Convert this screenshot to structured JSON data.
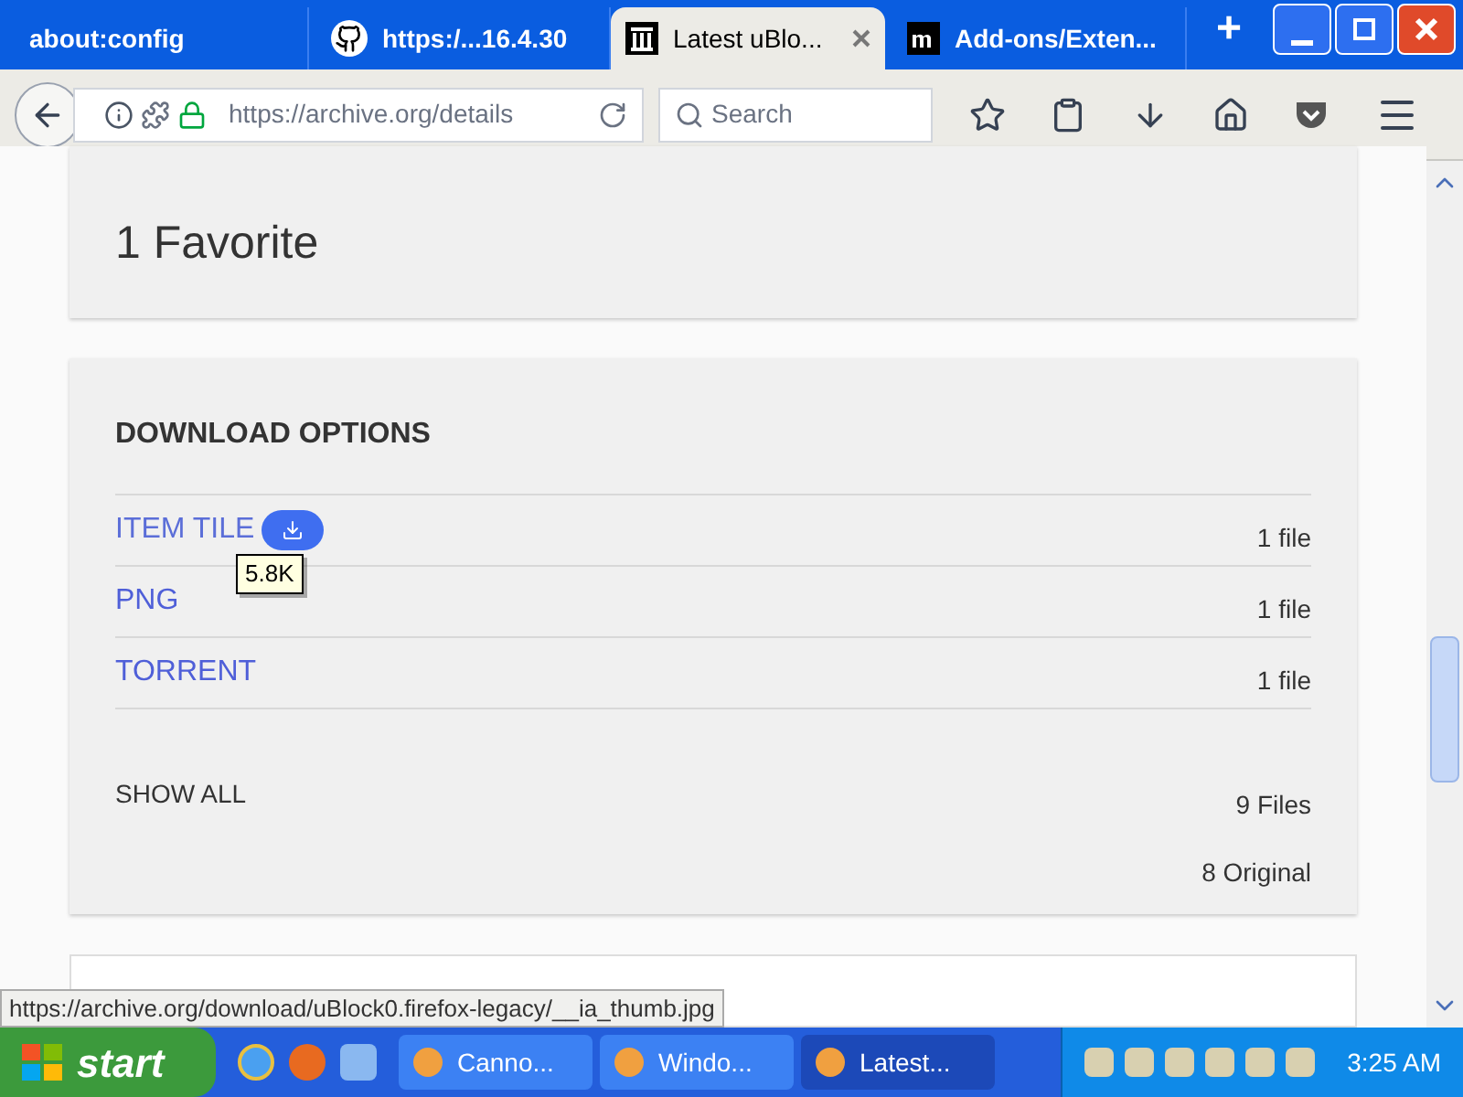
{
  "tabs": [
    {
      "label": "about:config",
      "selected": false
    },
    {
      "label": "https:/...16.4.30",
      "selected": false
    },
    {
      "label": "Latest uBlo...",
      "selected": true
    },
    {
      "label": "Add-ons/Exten...",
      "selected": false
    }
  ],
  "new_tab": "+",
  "toolbar": {
    "url_host": "https://archive.org/",
    "url_path": "details",
    "search_placeholder": "Search"
  },
  "stats": {
    "favorites": "1 Favorite"
  },
  "downloads": {
    "title": "DOWNLOAD OPTIONS",
    "items": [
      {
        "label": "ITEM TILE",
        "count": "1 file",
        "hovered": true
      },
      {
        "label": "PNG",
        "count": "1 file",
        "hovered": false
      },
      {
        "label": "TORRENT",
        "count": "1 file",
        "hovered": false
      }
    ],
    "tooltip": "5.8K",
    "show_all": "SHOW ALL",
    "files": "9 Files",
    "original": "8 Original"
  },
  "status_url": "https://archive.org/download/uBlock0.firefox-legacy/__ia_thumb.jpg",
  "taskbar": {
    "start": "start",
    "tasks": [
      {
        "label": "Canno...",
        "selected": false
      },
      {
        "label": "Windo...",
        "selected": false
      },
      {
        "label": "Latest...",
        "selected": true
      }
    ],
    "clock": "3:25 AM"
  }
}
